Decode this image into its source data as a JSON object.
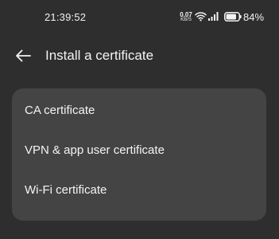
{
  "status_bar": {
    "time": "21:39:52",
    "net_speed_value": "0.07",
    "net_speed_unit": "KB/S",
    "battery_percent": "84%",
    "icons": [
      "wifi-icon",
      "signal-icon",
      "battery-icon"
    ]
  },
  "header": {
    "back_icon": "arrow-left-icon",
    "title": "Install a certificate"
  },
  "options": [
    {
      "label": "CA certificate"
    },
    {
      "label": "VPN & app user certificate"
    },
    {
      "label": "Wi-Fi certificate"
    }
  ],
  "colors": {
    "background": "#2e2e2e",
    "card": "#444444",
    "text": "#f4f4f4"
  }
}
